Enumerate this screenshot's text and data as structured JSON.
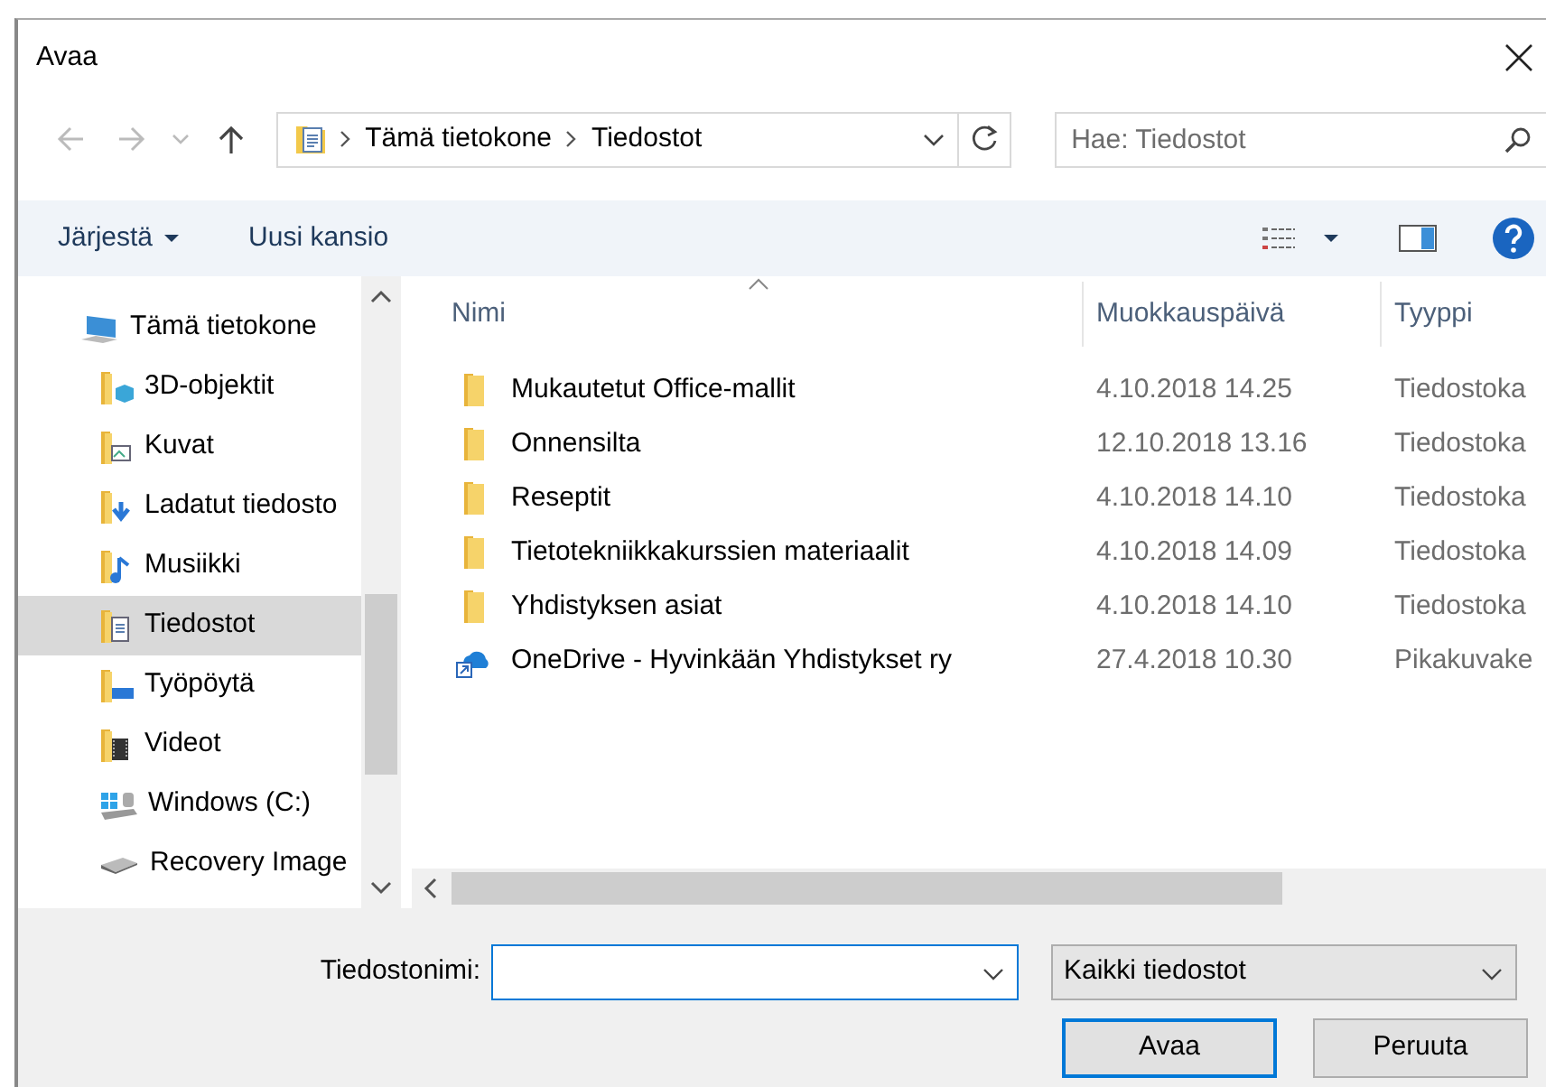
{
  "window": {
    "title": "Avaa"
  },
  "address": {
    "path": [
      "Tämä tietokone",
      "Tiedostot"
    ]
  },
  "search": {
    "placeholder": "Hae: Tiedostot"
  },
  "toolbar": {
    "organize": "Järjestä",
    "new_folder": "Uusi kansio"
  },
  "sidebar": {
    "items": [
      {
        "label": "Tämä tietokone",
        "kind": "computer",
        "selected": false,
        "children": [
          {
            "label": "3D-objektit",
            "kind": "objects",
            "selected": false
          },
          {
            "label": "Kuvat",
            "kind": "pictures",
            "selected": false
          },
          {
            "label": "Ladatut tiedosto",
            "kind": "downloads",
            "selected": false
          },
          {
            "label": "Musiikki",
            "kind": "music",
            "selected": false
          },
          {
            "label": "Tiedostot",
            "kind": "documents",
            "selected": true
          },
          {
            "label": "Työpöytä",
            "kind": "desktop",
            "selected": false
          },
          {
            "label": "Videot",
            "kind": "videos",
            "selected": false
          },
          {
            "label": "Windows (C:)",
            "kind": "system-drive",
            "selected": false
          },
          {
            "label": "Recovery Image",
            "kind": "drive",
            "selected": false
          }
        ]
      }
    ]
  },
  "table": {
    "columns": [
      {
        "label": "Nimi",
        "sorted": true
      },
      {
        "label": "Muokkauspäivä",
        "sorted": false
      },
      {
        "label": "Tyyppi",
        "sorted": false
      }
    ],
    "rows": [
      {
        "kind": "folder",
        "selected": false,
        "cells": [
          "Mukautetut Office-mallit",
          "4.10.2018 14.25",
          "Tiedostoka"
        ]
      },
      {
        "kind": "folder",
        "selected": false,
        "cells": [
          "Onnensilta",
          "12.10.2018 13.16",
          "Tiedostoka"
        ]
      },
      {
        "kind": "folder",
        "selected": false,
        "cells": [
          "Reseptit",
          "4.10.2018 14.10",
          "Tiedostoka"
        ]
      },
      {
        "kind": "folder",
        "selected": false,
        "cells": [
          "Tietotekniikkakurssien materiaalit",
          "4.10.2018 14.09",
          "Tiedostoka"
        ]
      },
      {
        "kind": "folder",
        "selected": false,
        "cells": [
          "Yhdistyksen asiat",
          "4.10.2018 14.10",
          "Tiedostoka"
        ]
      },
      {
        "kind": "shortcut",
        "selected": false,
        "cells": [
          "OneDrive - Hyvinkään Yhdistykset ry",
          "27.4.2018 10.30",
          "Pikakuvake"
        ]
      }
    ]
  },
  "footer": {
    "filename_label": "Tiedostonimi:",
    "filter": "Kaikki tiedostot",
    "buttons": [
      "Avaa",
      "Peruuta"
    ]
  }
}
